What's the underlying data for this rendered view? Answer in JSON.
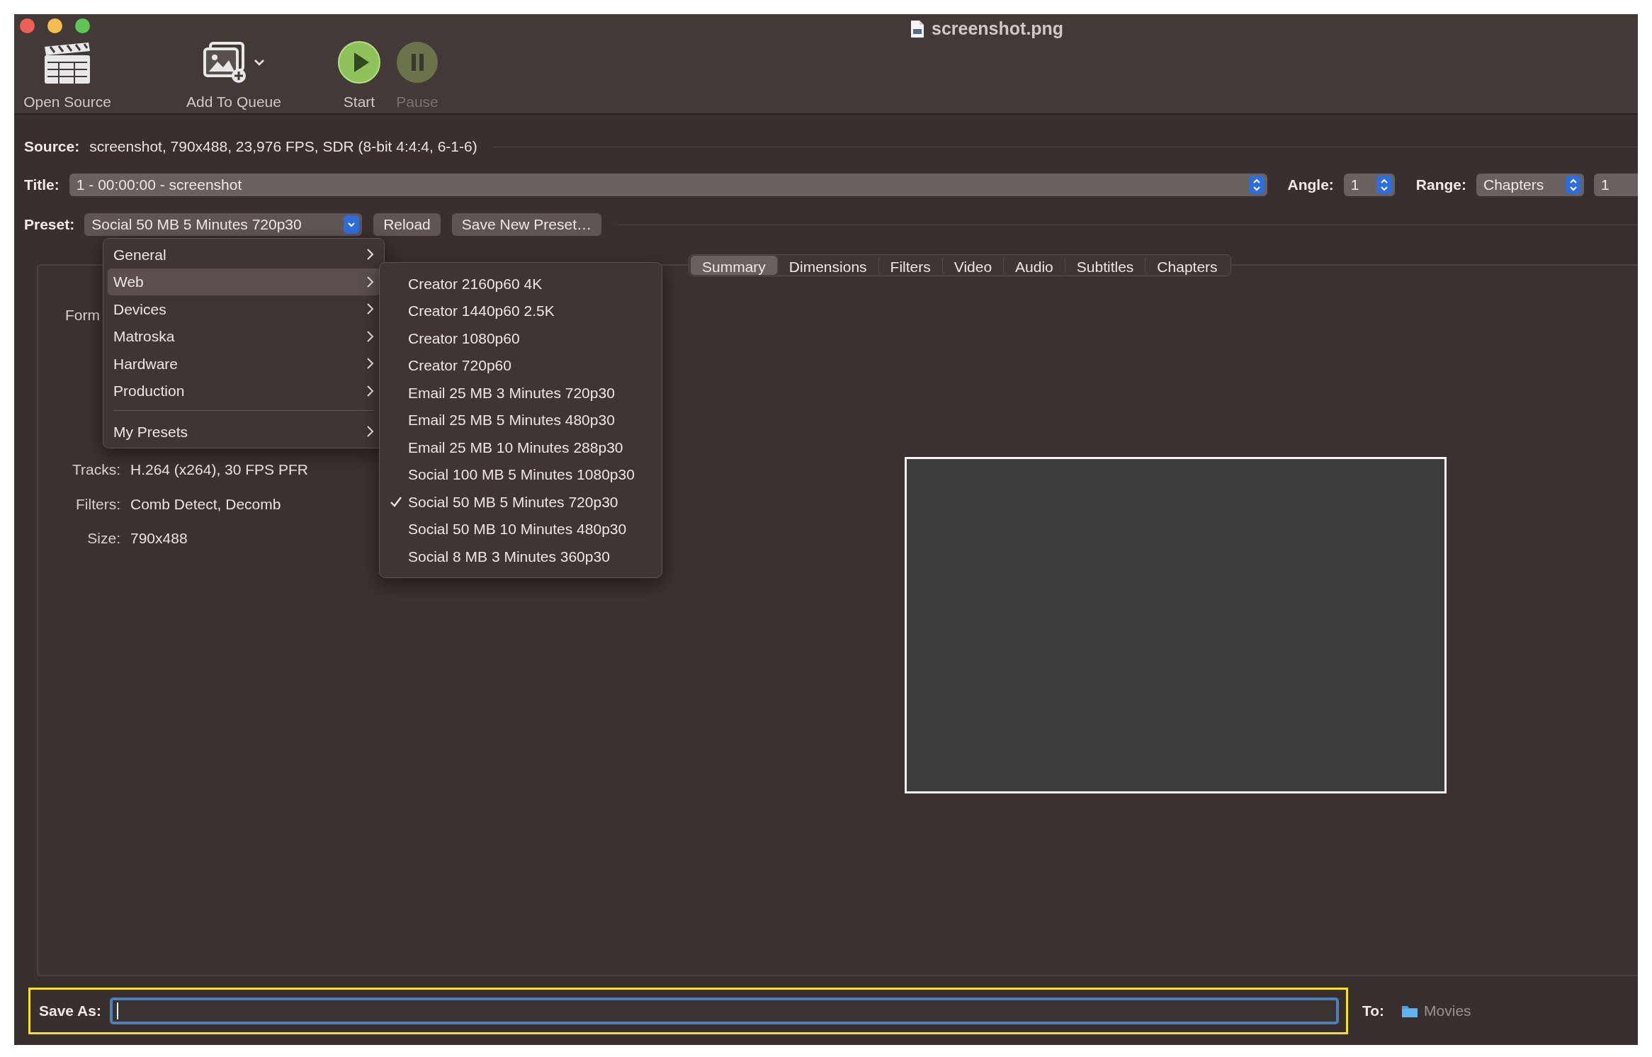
{
  "window": {
    "title": "screenshot.png"
  },
  "toolbar": [
    {
      "label": "Open Source",
      "kind": "clapper",
      "disabled": false
    },
    {
      "label": "Add To Queue",
      "kind": "queue",
      "disabled": false
    },
    {
      "label": "Start",
      "kind": "start",
      "disabled": false
    },
    {
      "label": "Pause",
      "kind": "pause",
      "disabled": true
    }
  ],
  "source": {
    "label": "Source:",
    "value": "screenshot, 790x488, 23,976 FPS, SDR (8-bit 4:4:4, 6-1-6)"
  },
  "title_row": {
    "label": "Title:",
    "value": "1 - 00:00:00 - screenshot"
  },
  "angle": {
    "label": "Angle:",
    "value": "1"
  },
  "range": {
    "label": "Range:",
    "value": "Chapters",
    "start": "1"
  },
  "preset": {
    "label": "Preset:",
    "value": "Social 50 MB 5 Minutes 720p30",
    "buttons": [
      "Reload",
      "Save New Preset…"
    ]
  },
  "tabs": [
    {
      "label": "Summary",
      "selected": true
    },
    {
      "label": "Dimensions",
      "selected": false
    },
    {
      "label": "Filters",
      "selected": false
    },
    {
      "label": "Video",
      "selected": false
    },
    {
      "label": "Audio",
      "selected": false
    },
    {
      "label": "Subtitles",
      "selected": false
    },
    {
      "label": "Chapters",
      "selected": false
    }
  ],
  "summary": {
    "cut_label": "Form",
    "rows": [
      {
        "label": "Tracks:",
        "value": "H.264 (x264), 30 FPS PFR"
      },
      {
        "label": "Filters:",
        "value": "Comb Detect, Decomb"
      },
      {
        "label": "Size:",
        "value": "790x488"
      }
    ]
  },
  "preset_menu": {
    "items": [
      {
        "kind": "item",
        "label": "General",
        "selected": false
      },
      {
        "kind": "item",
        "label": "Web",
        "selected": true
      },
      {
        "kind": "item",
        "label": "Devices",
        "selected": false
      },
      {
        "kind": "item",
        "label": "Matroska",
        "selected": false
      },
      {
        "kind": "item",
        "label": "Hardware",
        "selected": false
      },
      {
        "kind": "item",
        "label": "Production",
        "selected": false
      },
      {
        "kind": "separator"
      },
      {
        "kind": "item",
        "label": "My Presets",
        "selected": false
      }
    ]
  },
  "submenu": {
    "items": [
      {
        "label": "Creator 2160p60 4K",
        "checked": false
      },
      {
        "label": "Creator 1440p60 2.5K",
        "checked": false
      },
      {
        "label": "Creator 1080p60",
        "checked": false
      },
      {
        "label": "Creator 720p60",
        "checked": false
      },
      {
        "label": "Email 25 MB 3 Minutes 720p30",
        "checked": false
      },
      {
        "label": "Email 25 MB 5 Minutes 480p30",
        "checked": false
      },
      {
        "label": "Email 25 MB 10 Minutes 288p30",
        "checked": false
      },
      {
        "label": "Social 100 MB 5 Minutes 1080p30",
        "checked": false
      },
      {
        "label": "Social 50 MB 5 Minutes 720p30",
        "checked": true
      },
      {
        "label": "Social 50 MB 10 Minutes 480p30",
        "checked": false
      },
      {
        "label": "Social 8 MB 3 Minutes 360p30",
        "checked": false
      }
    ]
  },
  "save_as": {
    "label": "Save As:",
    "highlighted": true
  },
  "destination": {
    "label": "To:",
    "folder": "Movies"
  }
}
